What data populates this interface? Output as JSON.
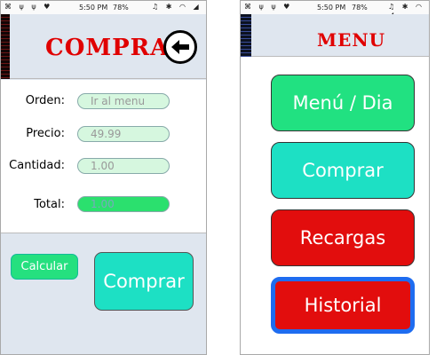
{
  "status_bar": {
    "time": "5:50 PM",
    "battery": "78%"
  },
  "compra_screen": {
    "title": "COMPRAR",
    "fields": {
      "orden": {
        "label": "Orden:",
        "placeholder": "Ir al menu"
      },
      "precio": {
        "label": "Precio:",
        "value": "49.99"
      },
      "cantidad": {
        "label": "Cantidad:",
        "value": "1.00"
      },
      "total": {
        "label": "Total:",
        "value": "1.00"
      }
    },
    "calcular_label": "Calcular",
    "comprar_label": "Comprar"
  },
  "menu_screen": {
    "title": "MENU",
    "buttons": {
      "menu_dia": "Menú / Dia",
      "comprar": "Comprar",
      "recargas": "Recargas",
      "historial": "Historial"
    }
  },
  "colors": {
    "title_red": "#e00000",
    "green": "#21e181",
    "teal": "#1de0c4",
    "red": "#e20d0d",
    "blue_border": "#1e6cf0",
    "header_bg": "#dfe6ef"
  }
}
